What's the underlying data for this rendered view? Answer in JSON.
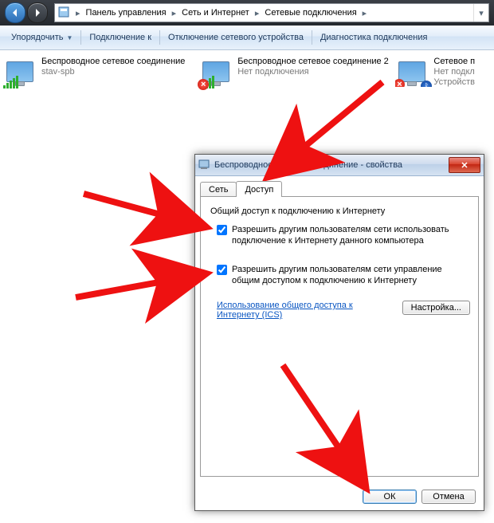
{
  "nav": {
    "crumbs": [
      "Панель управления",
      "Сеть и Интернет",
      "Сетевые подключения"
    ]
  },
  "toolbar": {
    "organize": "Упорядочить",
    "connect": "Подключение к",
    "disable": "Отключение сетевого устройства",
    "diagnose": "Диагностика подключения"
  },
  "connections": [
    {
      "title": "Беспроводное сетевое соединение",
      "subtitle": "stav-spb",
      "overlay": "none"
    },
    {
      "title": "Беспроводное сетевое соединение 2",
      "subtitle": "Нет подключения",
      "overlay": "x"
    },
    {
      "title": "Сетевое п",
      "subtitle": "Нет подкл",
      "detail": "Устройств",
      "overlay": "bt"
    }
  ],
  "dialog": {
    "title": "Беспроводное сетевое соединение - свойства",
    "tabs": {
      "network": "Сеть",
      "sharing": "Доступ"
    },
    "group_title": "Общий доступ к подключению к Интернету",
    "check1": "Разрешить другим пользователям сети использовать подключение к Интернету данного компьютера",
    "check2": "Разрешить другим пользователям сети управление общим доступом к подключению к Интернету",
    "link": "Использование общего доступа к Интернету (ICS)",
    "settings_btn": "Настройка...",
    "ok": "ОК",
    "cancel": "Отмена"
  }
}
